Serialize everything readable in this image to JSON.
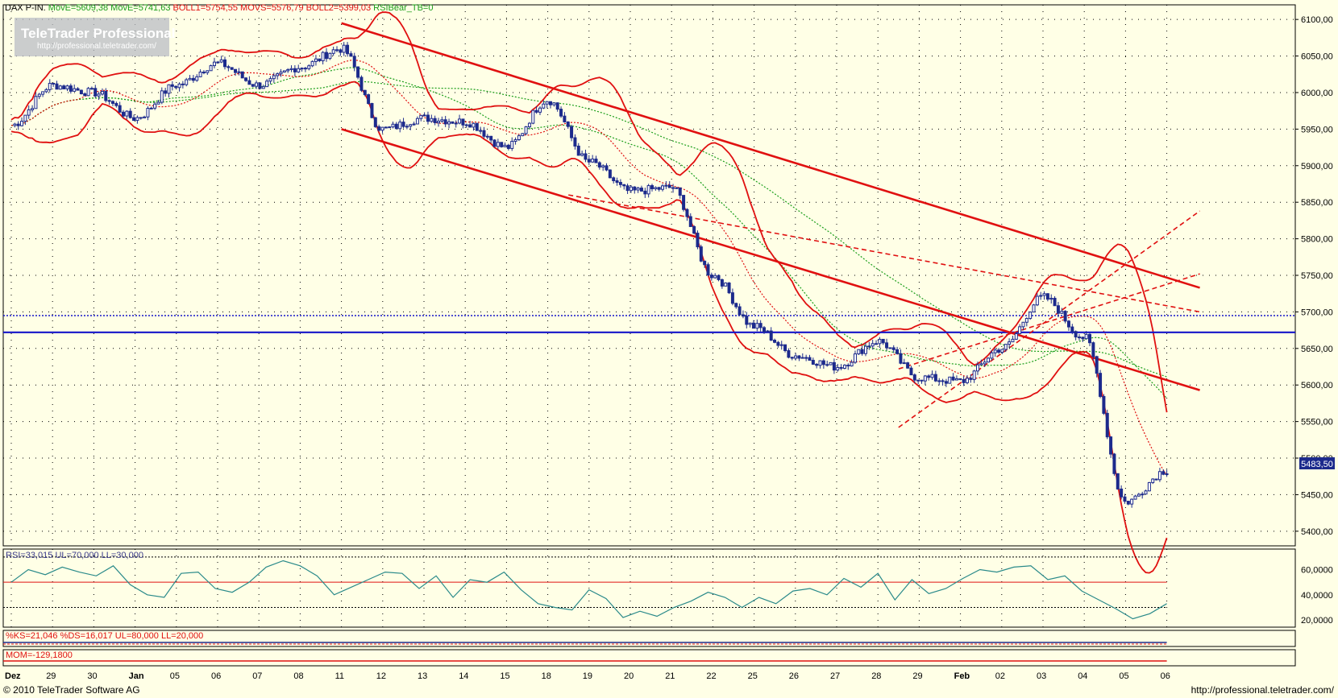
{
  "header": {
    "instrument": "DAX P-IN.",
    "indicators": [
      {
        "text": "MovE=5609,38",
        "color": "#1a9e1a"
      },
      {
        "text": "MovE=5741,63",
        "color": "#1a9e1a"
      },
      {
        "text": "BOLL1=5754,55",
        "color": "#e01010"
      },
      {
        "text": "MOVS=5576,79",
        "color": "#e01010"
      },
      {
        "text": "BOLL2=5399,03",
        "color": "#e01010"
      },
      {
        "text": "RSIBear_TB=0",
        "color": "#1a9e1a"
      }
    ]
  },
  "watermark": {
    "brand": "TeleTrader Professional",
    "url": "http://professional.teletrader.com/"
  },
  "price_panel": {
    "last_price_tag": "5483,50"
  },
  "rsi_panel": {
    "label": "RSI=33,015  UL=70,000  LL=30,000",
    "ticks": [
      "60,0000",
      "40,0000",
      "20,0000"
    ]
  },
  "ks_panel": {
    "label": "%KS=21,046  %DS=16,017  UL=80,000  LL=20,000"
  },
  "mom_panel": {
    "label": "MOM=-129,1800"
  },
  "footer": {
    "copyright": "© 2010 TeleTrader Software AG",
    "url": "http://professional.teletrader.com/"
  },
  "colors": {
    "background": "#ffffe6",
    "candle": "#1c2a8c",
    "channel": "#e01010",
    "support_line": "#1414c8",
    "ma_green": "#1a9e1a",
    "rsi_line": "#2a8a8a"
  },
  "chart_data": {
    "type": "candlestick",
    "title": "DAX P-IN.",
    "y_axis_ticks": [
      6100,
      6050,
      6000,
      5950,
      5900,
      5850,
      5800,
      5750,
      5700,
      5650,
      5600,
      5550,
      5500,
      5450,
      5400
    ],
    "y_tick_labels": [
      "6100,00",
      "6050,00",
      "6000,00",
      "5950,00",
      "5900,00",
      "5850,00",
      "5800,00",
      "5750,00",
      "5700,00",
      "5650,00",
      "5600,00",
      "5550,00",
      "5500,00",
      "5450,00",
      "5400,00"
    ],
    "ylim": [
      5380,
      6120
    ],
    "x_labels": [
      "Dez",
      "29",
      "30",
      "Jan",
      "05",
      "06",
      "07",
      "08",
      "11",
      "12",
      "13",
      "14",
      "15",
      "18",
      "19",
      "20",
      "21",
      "22",
      "25",
      "26",
      "27",
      "28",
      "29",
      "Feb",
      "02",
      "03",
      "04",
      "05",
      "06"
    ],
    "bold_x_labels": [
      "Dez",
      "Jan",
      "Feb"
    ],
    "horizontal_lines": [
      5695,
      5672
    ],
    "daily_closes": [
      5955,
      6010,
      6000,
      5965,
      6010,
      6040,
      6010,
      6035,
      6060,
      5950,
      5965,
      5960,
      5925,
      5990,
      5905,
      5865,
      5870,
      5750,
      5680,
      5640,
      5625,
      5660,
      5610,
      5605,
      5650,
      5720,
      5665,
      5440,
      5483.5
    ],
    "series": [
      {
        "name": "MovE",
        "value": 5609.38
      },
      {
        "name": "MovE",
        "value": 5741.63
      },
      {
        "name": "BOLL1",
        "value": 5754.55
      },
      {
        "name": "MOVS",
        "value": 5576.79
      },
      {
        "name": "BOLL2",
        "value": 5399.03
      }
    ],
    "rsi": {
      "value": 33.015,
      "ul": 70,
      "ll": 30,
      "ylim": [
        15,
        75
      ],
      "values": [
        50,
        60,
        56,
        62,
        58,
        55,
        63,
        48,
        40,
        38,
        57,
        58,
        45,
        42,
        50,
        62,
        67,
        63,
        55,
        40,
        46,
        52,
        58,
        57,
        45,
        55,
        38,
        52,
        50,
        58,
        44,
        33,
        30,
        28,
        44,
        37,
        22,
        27,
        23,
        30,
        35,
        42,
        38,
        30,
        38,
        33,
        43,
        45,
        40,
        53,
        46,
        57,
        36,
        52,
        41,
        45,
        53,
        60,
        58,
        62,
        63,
        52,
        55,
        43,
        36,
        29,
        21,
        25,
        33
      ]
    },
    "ks": {
      "ks": 21.046,
      "ds": 16.017,
      "ul": 80,
      "ll": 20
    },
    "momentum": {
      "value": -129.18
    }
  }
}
